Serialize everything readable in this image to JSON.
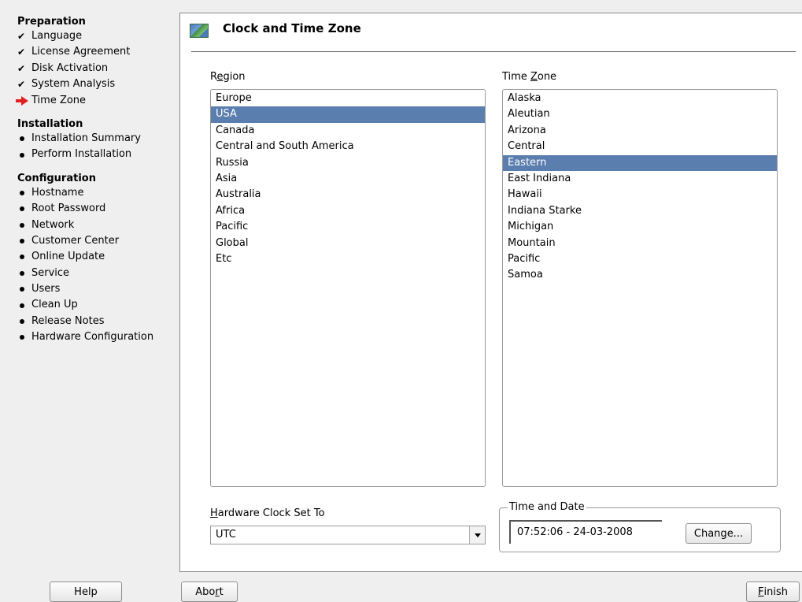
{
  "sidebar": {
    "sections": [
      {
        "title": "Preparation",
        "steps": [
          {
            "label": "Language",
            "status": "done"
          },
          {
            "label": "License Agreement",
            "status": "done"
          },
          {
            "label": "Disk Activation",
            "status": "done"
          },
          {
            "label": "System Analysis",
            "status": "done"
          },
          {
            "label": "Time Zone",
            "status": "current"
          }
        ]
      },
      {
        "title": "Installation",
        "steps": [
          {
            "label": "Installation Summary",
            "status": "pending"
          },
          {
            "label": "Perform Installation",
            "status": "pending"
          }
        ]
      },
      {
        "title": "Configuration",
        "steps": [
          {
            "label": "Hostname",
            "status": "pending"
          },
          {
            "label": "Root Password",
            "status": "pending"
          },
          {
            "label": "Network",
            "status": "pending"
          },
          {
            "label": "Customer Center",
            "status": "pending"
          },
          {
            "label": "Online Update",
            "status": "pending"
          },
          {
            "label": "Service",
            "status": "pending"
          },
          {
            "label": "Users",
            "status": "pending"
          },
          {
            "label": "Clean Up",
            "status": "pending"
          },
          {
            "label": "Release Notes",
            "status": "pending"
          },
          {
            "label": "Hardware Configuration",
            "status": "pending"
          }
        ]
      }
    ]
  },
  "main": {
    "title": "Clock and Time Zone",
    "title_icon": "world-map-icon",
    "region": {
      "label_pre": "R",
      "label_mnemonic": "e",
      "label_post": "gion",
      "items": [
        "Europe",
        "USA",
        "Canada",
        "Central and South America",
        "Russia",
        "Asia",
        "Australia",
        "Africa",
        "Pacific",
        "Global",
        "Etc"
      ],
      "selected": "USA"
    },
    "timezone": {
      "label_pre": "Time ",
      "label_mnemonic": "Z",
      "label_post": "one",
      "items": [
        "Alaska",
        "Aleutian",
        "Arizona",
        "Central",
        "Eastern",
        "East Indiana",
        "Hawaii",
        "Indiana Starke",
        "Michigan",
        "Mountain",
        "Pacific",
        "Samoa"
      ],
      "selected": "Eastern"
    },
    "hardware_clock": {
      "label_pre": "",
      "label_mnemonic": "H",
      "label_post": "ardware Clock Set To",
      "value": "UTC"
    },
    "time_and_date": {
      "legend": "Time and Date",
      "value": "07:52:06 - 24-03-2008",
      "change_pre": "Chan",
      "change_mnemonic": "g",
      "change_post": "e..."
    }
  },
  "buttons": {
    "help": "Help",
    "abort_pre": "Abo",
    "abort_mnemonic": "r",
    "abort_post": "t",
    "finish_pre": "",
    "finish_mnemonic": "F",
    "finish_post": "inish"
  },
  "colors": {
    "selection": "#5a7eae",
    "current_step_arrow": "#e02020"
  }
}
